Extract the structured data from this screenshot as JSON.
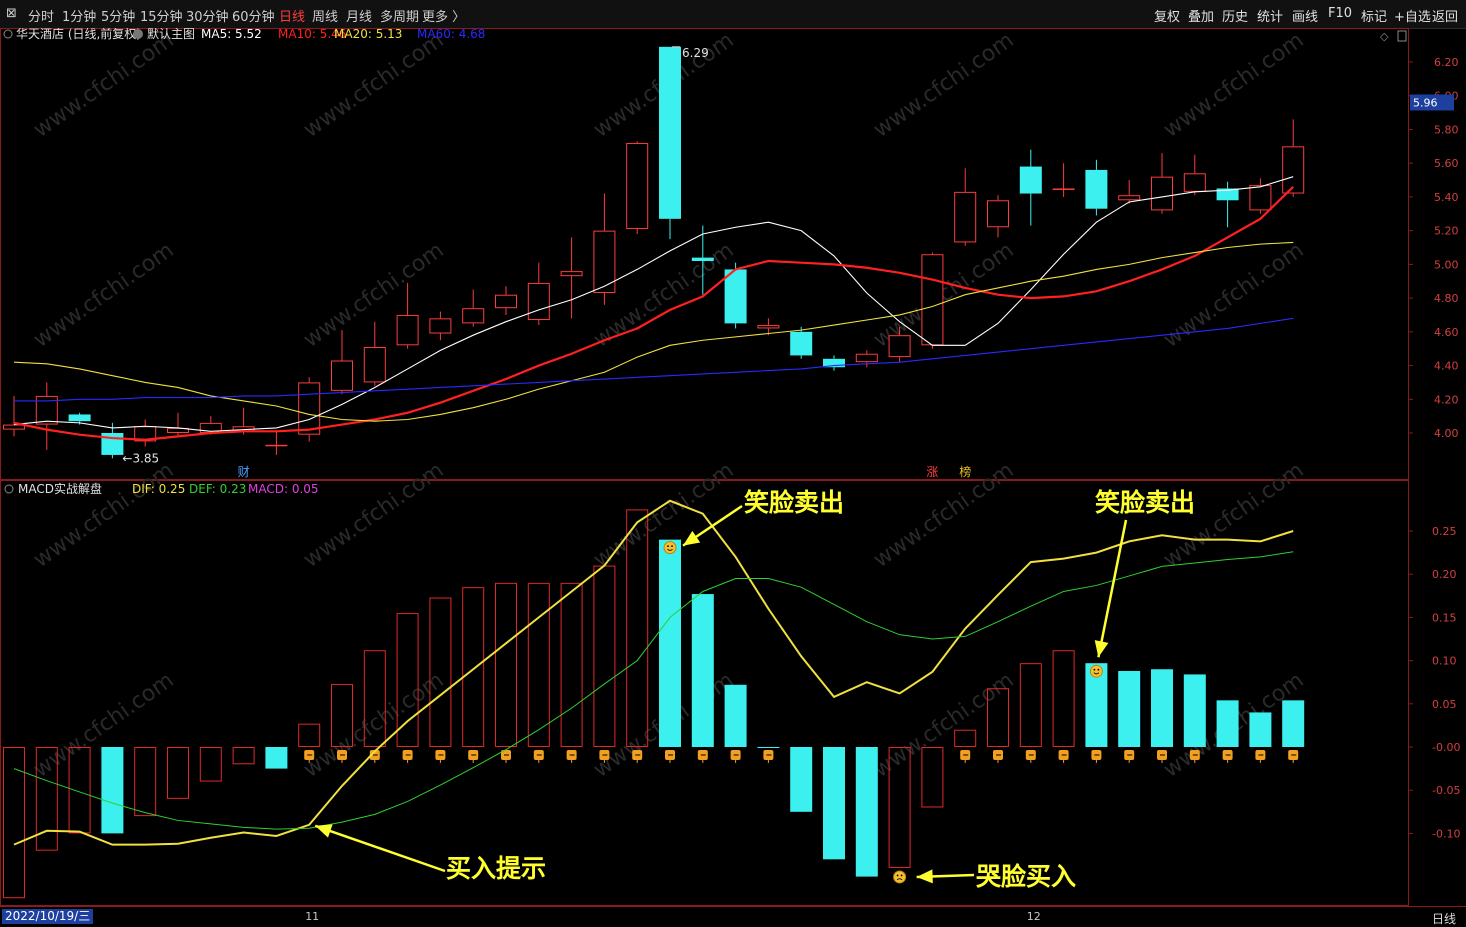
{
  "toolbar": {
    "left_items": [
      "分时",
      "1分钟",
      "5分钟",
      "15分钟",
      "30分钟",
      "60分钟",
      "日线",
      "周线",
      "月线",
      "多周期",
      "更多 〉"
    ],
    "active_item": "日线",
    "right_items": [
      "复权",
      "叠加",
      "历史",
      "统计",
      "画线",
      "F10",
      "标记",
      "+自选",
      "返回"
    ]
  },
  "main_panel": {
    "title": "华天酒店 (日线,前复权)",
    "template": "默认主图",
    "ma_labels": [
      {
        "text": "MA5: 5.52",
        "color": "#ffffff"
      },
      {
        "text": "MA10: 5.46",
        "color": "#ff2020"
      },
      {
        "text": "MA20: 5.13",
        "color": "#f0e040"
      },
      {
        "text": "MA60: 4.68",
        "color": "#2a2aff"
      }
    ],
    "high_label": "6.29",
    "low_label": "3.85",
    "current_price": "5.96",
    "markers": [
      {
        "text": "财",
        "color": "#4aa0ff",
        "index": 7
      },
      {
        "text": "涨",
        "color": "#ff4040",
        "index": 28
      },
      {
        "text": "榜",
        "color": "#e8c020",
        "index": 29
      }
    ]
  },
  "sub_panel": {
    "title": "MACD实战解盘",
    "labels": [
      {
        "text": "DIF: 0.25",
        "color": "#f0e040"
      },
      {
        "text": "DEF: 0.23",
        "color": "#30d030"
      },
      {
        "text": "MACD: 0.05",
        "color": "#e040e0"
      }
    ]
  },
  "annotations": [
    {
      "text": "笑脸卖出",
      "target_index": 20
    },
    {
      "text": "笑脸卖出",
      "target_index": 33
    },
    {
      "text": "买入提示",
      "target_index": 9
    },
    {
      "text": "哭脸买入",
      "target_index": 27
    }
  ],
  "x_axis": {
    "date_label": "2022/10/19/三",
    "month_ticks": [
      {
        "text": "11",
        "index": 9
      },
      {
        "text": "12",
        "index": 31
      }
    ]
  },
  "period_label": "日线",
  "watermark": "www.cfchi.com",
  "chart_data": [
    {
      "type": "candlestick",
      "title": "华天酒店 (日线,前复权)",
      "y_ticks": [
        "6.20",
        "6.00",
        "5.80",
        "5.60",
        "5.40",
        "5.20",
        "5.00",
        "4.80",
        "4.60",
        "4.40",
        "4.20",
        "4.00"
      ],
      "ylim": [
        3.72,
        6.47
      ],
      "candles": [
        {
          "o": 4.02,
          "h": 4.22,
          "l": 3.98,
          "c": 4.05
        },
        {
          "o": 4.05,
          "h": 4.3,
          "l": 3.9,
          "c": 4.22
        },
        {
          "o": 4.11,
          "h": 4.12,
          "l": 4.05,
          "c": 4.07
        },
        {
          "o": 4.0,
          "h": 4.06,
          "l": 3.85,
          "c": 3.87
        },
        {
          "o": 3.95,
          "h": 4.08,
          "l": 3.92,
          "c": 4.04
        },
        {
          "o": 4.0,
          "h": 4.12,
          "l": 3.98,
          "c": 4.03
        },
        {
          "o": 4.0,
          "h": 4.1,
          "l": 3.99,
          "c": 4.06
        },
        {
          "o": 4.01,
          "h": 4.15,
          "l": 3.99,
          "c": 4.04
        },
        {
          "o": 3.93,
          "h": 4.01,
          "l": 3.87,
          "c": 3.93
        },
        {
          "o": 3.99,
          "h": 4.33,
          "l": 3.95,
          "c": 4.3
        },
        {
          "o": 4.25,
          "h": 4.61,
          "l": 4.23,
          "c": 4.43
        },
        {
          "o": 4.3,
          "h": 4.66,
          "l": 4.28,
          "c": 4.51
        },
        {
          "o": 4.52,
          "h": 4.89,
          "l": 4.5,
          "c": 4.7
        },
        {
          "o": 4.59,
          "h": 4.72,
          "l": 4.55,
          "c": 4.68
        },
        {
          "o": 4.65,
          "h": 4.85,
          "l": 4.63,
          "c": 4.74
        },
        {
          "o": 4.74,
          "h": 4.87,
          "l": 4.7,
          "c": 4.82
        },
        {
          "o": 4.67,
          "h": 5.01,
          "l": 4.64,
          "c": 4.89
        },
        {
          "o": 4.93,
          "h": 5.16,
          "l": 4.68,
          "c": 4.96
        },
        {
          "o": 4.83,
          "h": 5.42,
          "l": 4.76,
          "c": 5.2
        },
        {
          "o": 5.21,
          "h": 5.73,
          "l": 5.18,
          "c": 5.72
        },
        {
          "o": 6.29,
          "h": 6.29,
          "l": 5.15,
          "c": 5.27
        },
        {
          "o": 5.04,
          "h": 5.23,
          "l": 4.82,
          "c": 5.02
        },
        {
          "o": 4.97,
          "h": 5.01,
          "l": 4.62,
          "c": 4.65
        },
        {
          "o": 4.62,
          "h": 4.68,
          "l": 4.58,
          "c": 4.64
        },
        {
          "o": 4.6,
          "h": 4.63,
          "l": 4.44,
          "c": 4.46
        },
        {
          "o": 4.44,
          "h": 4.46,
          "l": 4.37,
          "c": 4.39
        },
        {
          "o": 4.42,
          "h": 4.49,
          "l": 4.39,
          "c": 4.47
        },
        {
          "o": 4.45,
          "h": 4.63,
          "l": 4.42,
          "c": 4.58
        },
        {
          "o": 4.52,
          "h": 5.07,
          "l": 4.5,
          "c": 5.06
        },
        {
          "o": 5.13,
          "h": 5.57,
          "l": 5.11,
          "c": 5.43
        },
        {
          "o": 5.22,
          "h": 5.41,
          "l": 5.16,
          "c": 5.38
        },
        {
          "o": 5.58,
          "h": 5.68,
          "l": 5.23,
          "c": 5.42
        },
        {
          "o": 5.45,
          "h": 5.6,
          "l": 5.4,
          "c": 5.45
        },
        {
          "o": 5.56,
          "h": 5.62,
          "l": 5.29,
          "c": 5.33
        },
        {
          "o": 5.38,
          "h": 5.5,
          "l": 5.36,
          "c": 5.41
        },
        {
          "o": 5.32,
          "h": 5.66,
          "l": 5.3,
          "c": 5.52
        },
        {
          "o": 5.43,
          "h": 5.65,
          "l": 5.41,
          "c": 5.54
        },
        {
          "o": 5.45,
          "h": 5.49,
          "l": 5.22,
          "c": 5.38
        },
        {
          "o": 5.32,
          "h": 5.51,
          "l": 5.3,
          "c": 5.47
        },
        {
          "o": 5.42,
          "h": 5.86,
          "l": 5.4,
          "c": 5.7
        }
      ],
      "series": [
        {
          "name": "MA5",
          "color": "#ffffff",
          "values": [
            4.05,
            4.07,
            4.06,
            4.03,
            4.04,
            4.03,
            4.01,
            4.02,
            4.03,
            4.08,
            4.17,
            4.27,
            4.38,
            4.49,
            4.58,
            4.66,
            4.73,
            4.79,
            4.87,
            4.97,
            5.08,
            5.18,
            5.22,
            5.25,
            5.2,
            5.05,
            4.83,
            4.66,
            4.52,
            4.52,
            4.65,
            4.85,
            5.06,
            5.25,
            5.37,
            5.4,
            5.43,
            5.44,
            5.46,
            5.52
          ]
        },
        {
          "name": "MA10",
          "color": "#ff2020",
          "values": [
            4.06,
            4.02,
            3.99,
            3.97,
            3.96,
            3.98,
            4.0,
            4.01,
            4.01,
            4.02,
            4.05,
            4.08,
            4.12,
            4.18,
            4.25,
            4.32,
            4.4,
            4.47,
            4.55,
            4.62,
            4.73,
            4.81,
            4.97,
            5.02,
            5.01,
            5.0,
            4.98,
            4.95,
            4.91,
            4.86,
            4.82,
            4.8,
            4.81,
            4.84,
            4.9,
            4.97,
            5.05,
            5.16,
            5.27,
            5.46
          ]
        },
        {
          "name": "MA20",
          "color": "#f0e040",
          "values": [
            4.42,
            4.41,
            4.38,
            4.34,
            4.3,
            4.27,
            4.22,
            4.19,
            4.16,
            4.11,
            4.08,
            4.07,
            4.08,
            4.11,
            4.15,
            4.2,
            4.26,
            4.31,
            4.36,
            4.45,
            4.52,
            4.55,
            4.57,
            4.59,
            4.61,
            4.64,
            4.67,
            4.7,
            4.75,
            4.82,
            4.86,
            4.9,
            4.93,
            4.97,
            5.0,
            5.04,
            5.07,
            5.1,
            5.12,
            5.13
          ]
        },
        {
          "name": "MA60",
          "color": "#2a2aff",
          "values": [
            4.19,
            4.19,
            4.2,
            4.2,
            4.21,
            4.21,
            4.21,
            4.22,
            4.22,
            4.23,
            4.24,
            4.25,
            4.26,
            4.27,
            4.28,
            4.29,
            4.3,
            4.31,
            4.32,
            4.33,
            4.34,
            4.35,
            4.36,
            4.37,
            4.38,
            4.4,
            4.41,
            4.42,
            4.44,
            4.46,
            4.48,
            4.5,
            4.52,
            4.54,
            4.56,
            4.58,
            4.6,
            4.62,
            4.65,
            4.68
          ]
        }
      ]
    },
    {
      "type": "bar",
      "title": "MACD实战解盘",
      "y_ticks": [
        "0.25",
        "0.20",
        "0.15",
        "0.10",
        "0.05",
        "-0.00",
        "-0.05",
        "-0.10"
      ],
      "ylim": [
        -0.175,
        0.31
      ],
      "macd": [
        -0.175,
        -0.12,
        -0.1,
        -0.1,
        -0.08,
        -0.06,
        -0.04,
        -0.02,
        -0.025,
        0.027,
        0.073,
        0.112,
        0.155,
        0.173,
        0.185,
        0.19,
        0.19,
        0.19,
        0.21,
        0.275,
        0.24,
        0.177,
        0.072,
        0.0,
        -0.075,
        -0.13,
        -0.15,
        -0.14,
        -0.07,
        0.02,
        0.068,
        0.097,
        0.112,
        0.097,
        0.088,
        0.09,
        0.084,
        0.054,
        0.04,
        0.054
      ],
      "series": [
        {
          "name": "DIF",
          "color": "#f0e040",
          "values": [
            -0.113,
            -0.097,
            -0.098,
            -0.113,
            -0.113,
            -0.112,
            -0.105,
            -0.099,
            -0.103,
            -0.09,
            -0.045,
            -0.005,
            0.03,
            0.06,
            0.09,
            0.12,
            0.15,
            0.18,
            0.21,
            0.26,
            0.285,
            0.27,
            0.22,
            0.16,
            0.105,
            0.058,
            0.075,
            0.062,
            0.087,
            0.137,
            0.176,
            0.214,
            0.218,
            0.225,
            0.238,
            0.245,
            0.24,
            0.24,
            0.238,
            0.25
          ]
        },
        {
          "name": "DEF",
          "color": "#30d030",
          "values": [
            -0.025,
            -0.039,
            -0.052,
            -0.065,
            -0.076,
            -0.085,
            -0.089,
            -0.093,
            -0.095,
            -0.094,
            -0.087,
            -0.078,
            -0.063,
            -0.044,
            -0.024,
            -0.003,
            0.02,
            0.045,
            0.073,
            0.1,
            0.15,
            0.18,
            0.195,
            0.195,
            0.185,
            0.165,
            0.145,
            0.13,
            0.125,
            0.128,
            0.145,
            0.163,
            0.18,
            0.187,
            0.198,
            0.209,
            0.213,
            0.217,
            0.22,
            0.226
          ]
        }
      ]
    }
  ]
}
